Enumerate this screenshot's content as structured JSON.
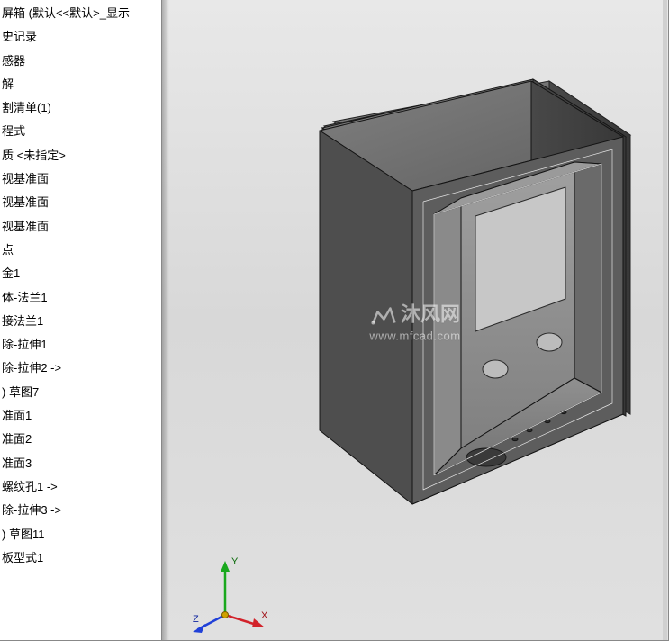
{
  "sidebar": {
    "items": [
      "屏箱    (默认<<默认>_显示",
      "史记录",
      "感器",
      "解",
      "割清单(1)",
      "程式",
      "质 <未指定>",
      "视基准面",
      "视基准面",
      "视基准面",
      "点",
      "金1",
      "体-法兰1",
      "接法兰1",
      "除-拉伸1",
      "除-拉伸2 ->",
      ")  草图7",
      "准面1",
      "准面2",
      "准面3",
      "  螺纹孔1 ->",
      "除-拉伸3 ->",
      ")  草图11",
      "板型式1"
    ]
  },
  "watermark": {
    "main": "沐风网",
    "sub": "www.mfcad.com"
  },
  "axes": {
    "x": "X",
    "y": "Y",
    "z": "Z"
  }
}
